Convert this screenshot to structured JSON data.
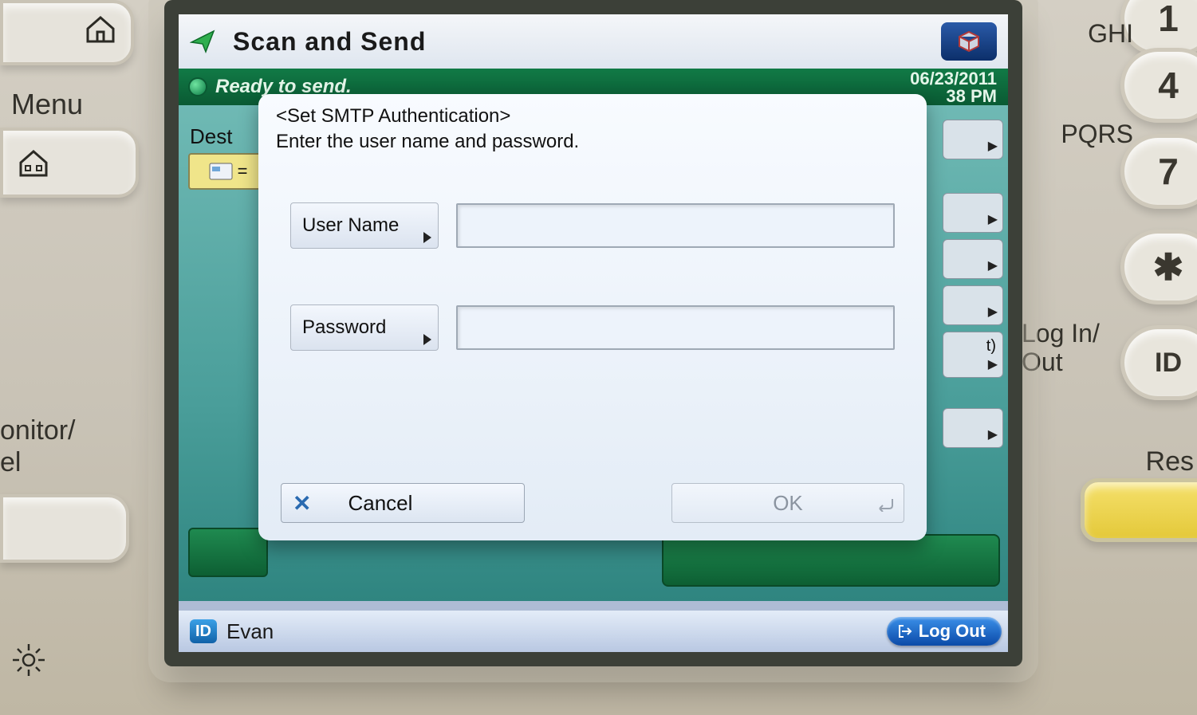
{
  "physical": {
    "menu_label": "Menu",
    "monitor_label": "onitor/\nel",
    "keypad": {
      "ghi": "GHI",
      "pqrs": "PQRS",
      "k1": "1",
      "k4": "4",
      "k7": "7",
      "star": "✱",
      "login_label": "Log In/\nOut",
      "id": "ID",
      "reset_label": "Res"
    }
  },
  "appbar": {
    "title": "Scan  and  Send"
  },
  "status": {
    "text": "Ready to send.",
    "date": "06/23/2011",
    "time": "38 PM"
  },
  "background": {
    "dest_label": "Dest",
    "side_fragment": "t)"
  },
  "modal": {
    "title": "<Set SMTP Authentication>",
    "subtitle": "Enter the user name and password.",
    "username_label": "User Name",
    "username_value": "",
    "password_label": "Password",
    "password_value": "",
    "cancel_label": "Cancel",
    "ok_label": "OK"
  },
  "userbar": {
    "id_chip": "ID",
    "username": "Evan",
    "logout_label": "Log Out"
  }
}
